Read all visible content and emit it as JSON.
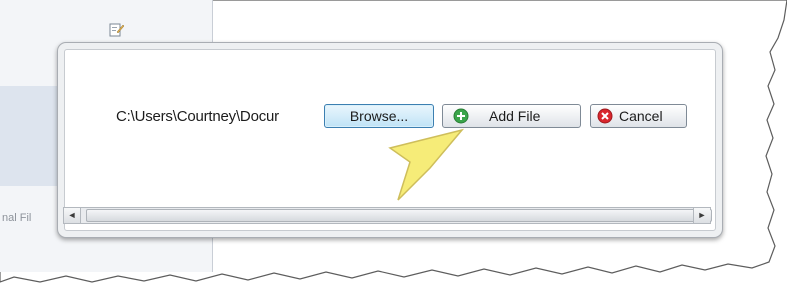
{
  "background_app": {
    "partial_label": "nal Fil"
  },
  "dialog": {
    "file_path_value": "C:\\Users\\Courtney\\Docur",
    "browse_label": "Browse...",
    "add_file_label": "Add File",
    "cancel_label": "Cancel"
  },
  "scrollbar": {
    "left_arrow": "◄",
    "right_arrow": "►"
  },
  "icons": {
    "add": "add-circle-icon",
    "cancel": "cancel-circle-icon",
    "app": "document-edit-icon"
  },
  "colors": {
    "add_icon": "#3aa54a",
    "cancel_icon": "#d9262c",
    "pointer": "#f6ea6a",
    "browse_border": "#3c7fb1"
  }
}
